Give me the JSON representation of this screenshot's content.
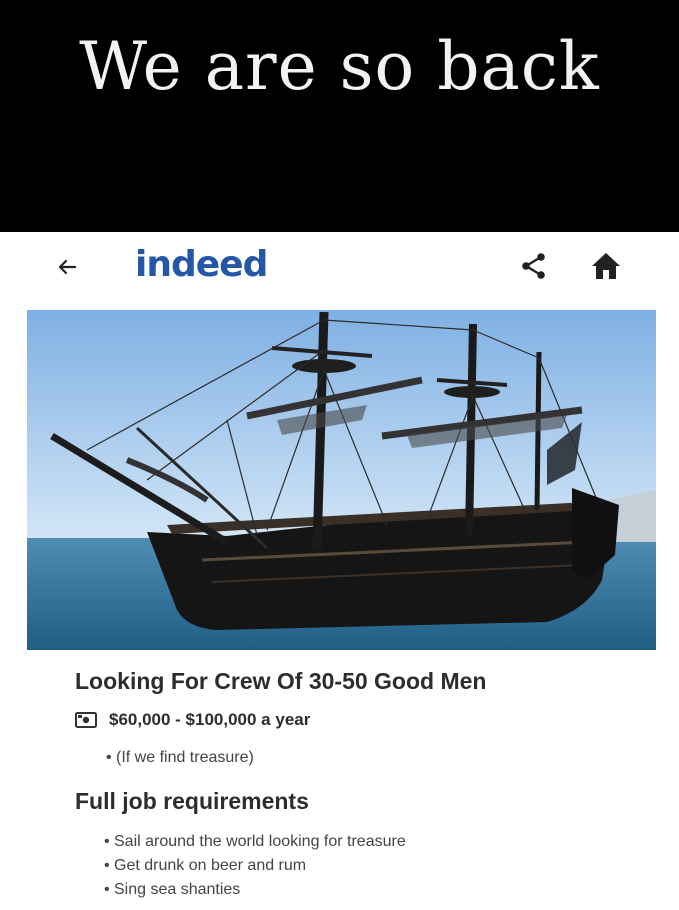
{
  "banner": {
    "title": "We are so back"
  },
  "nav": {
    "back_icon": "arrow-left-icon",
    "logo": "indeed",
    "share_icon": "share-icon",
    "home_icon": "home-icon",
    "brand_color": "#2557a7"
  },
  "job": {
    "title": "Looking For Crew Of 30-50 Good Men",
    "salary": "$60,000 - $100,000 a year",
    "salary_icon": "money-icon",
    "salary_note": "(If we find treasure)"
  },
  "requirements": {
    "heading": "Full job requirements",
    "items": [
      "Sail around the world looking for treasure",
      "Get drunk on beer and rum",
      "Sing sea shanties"
    ]
  }
}
